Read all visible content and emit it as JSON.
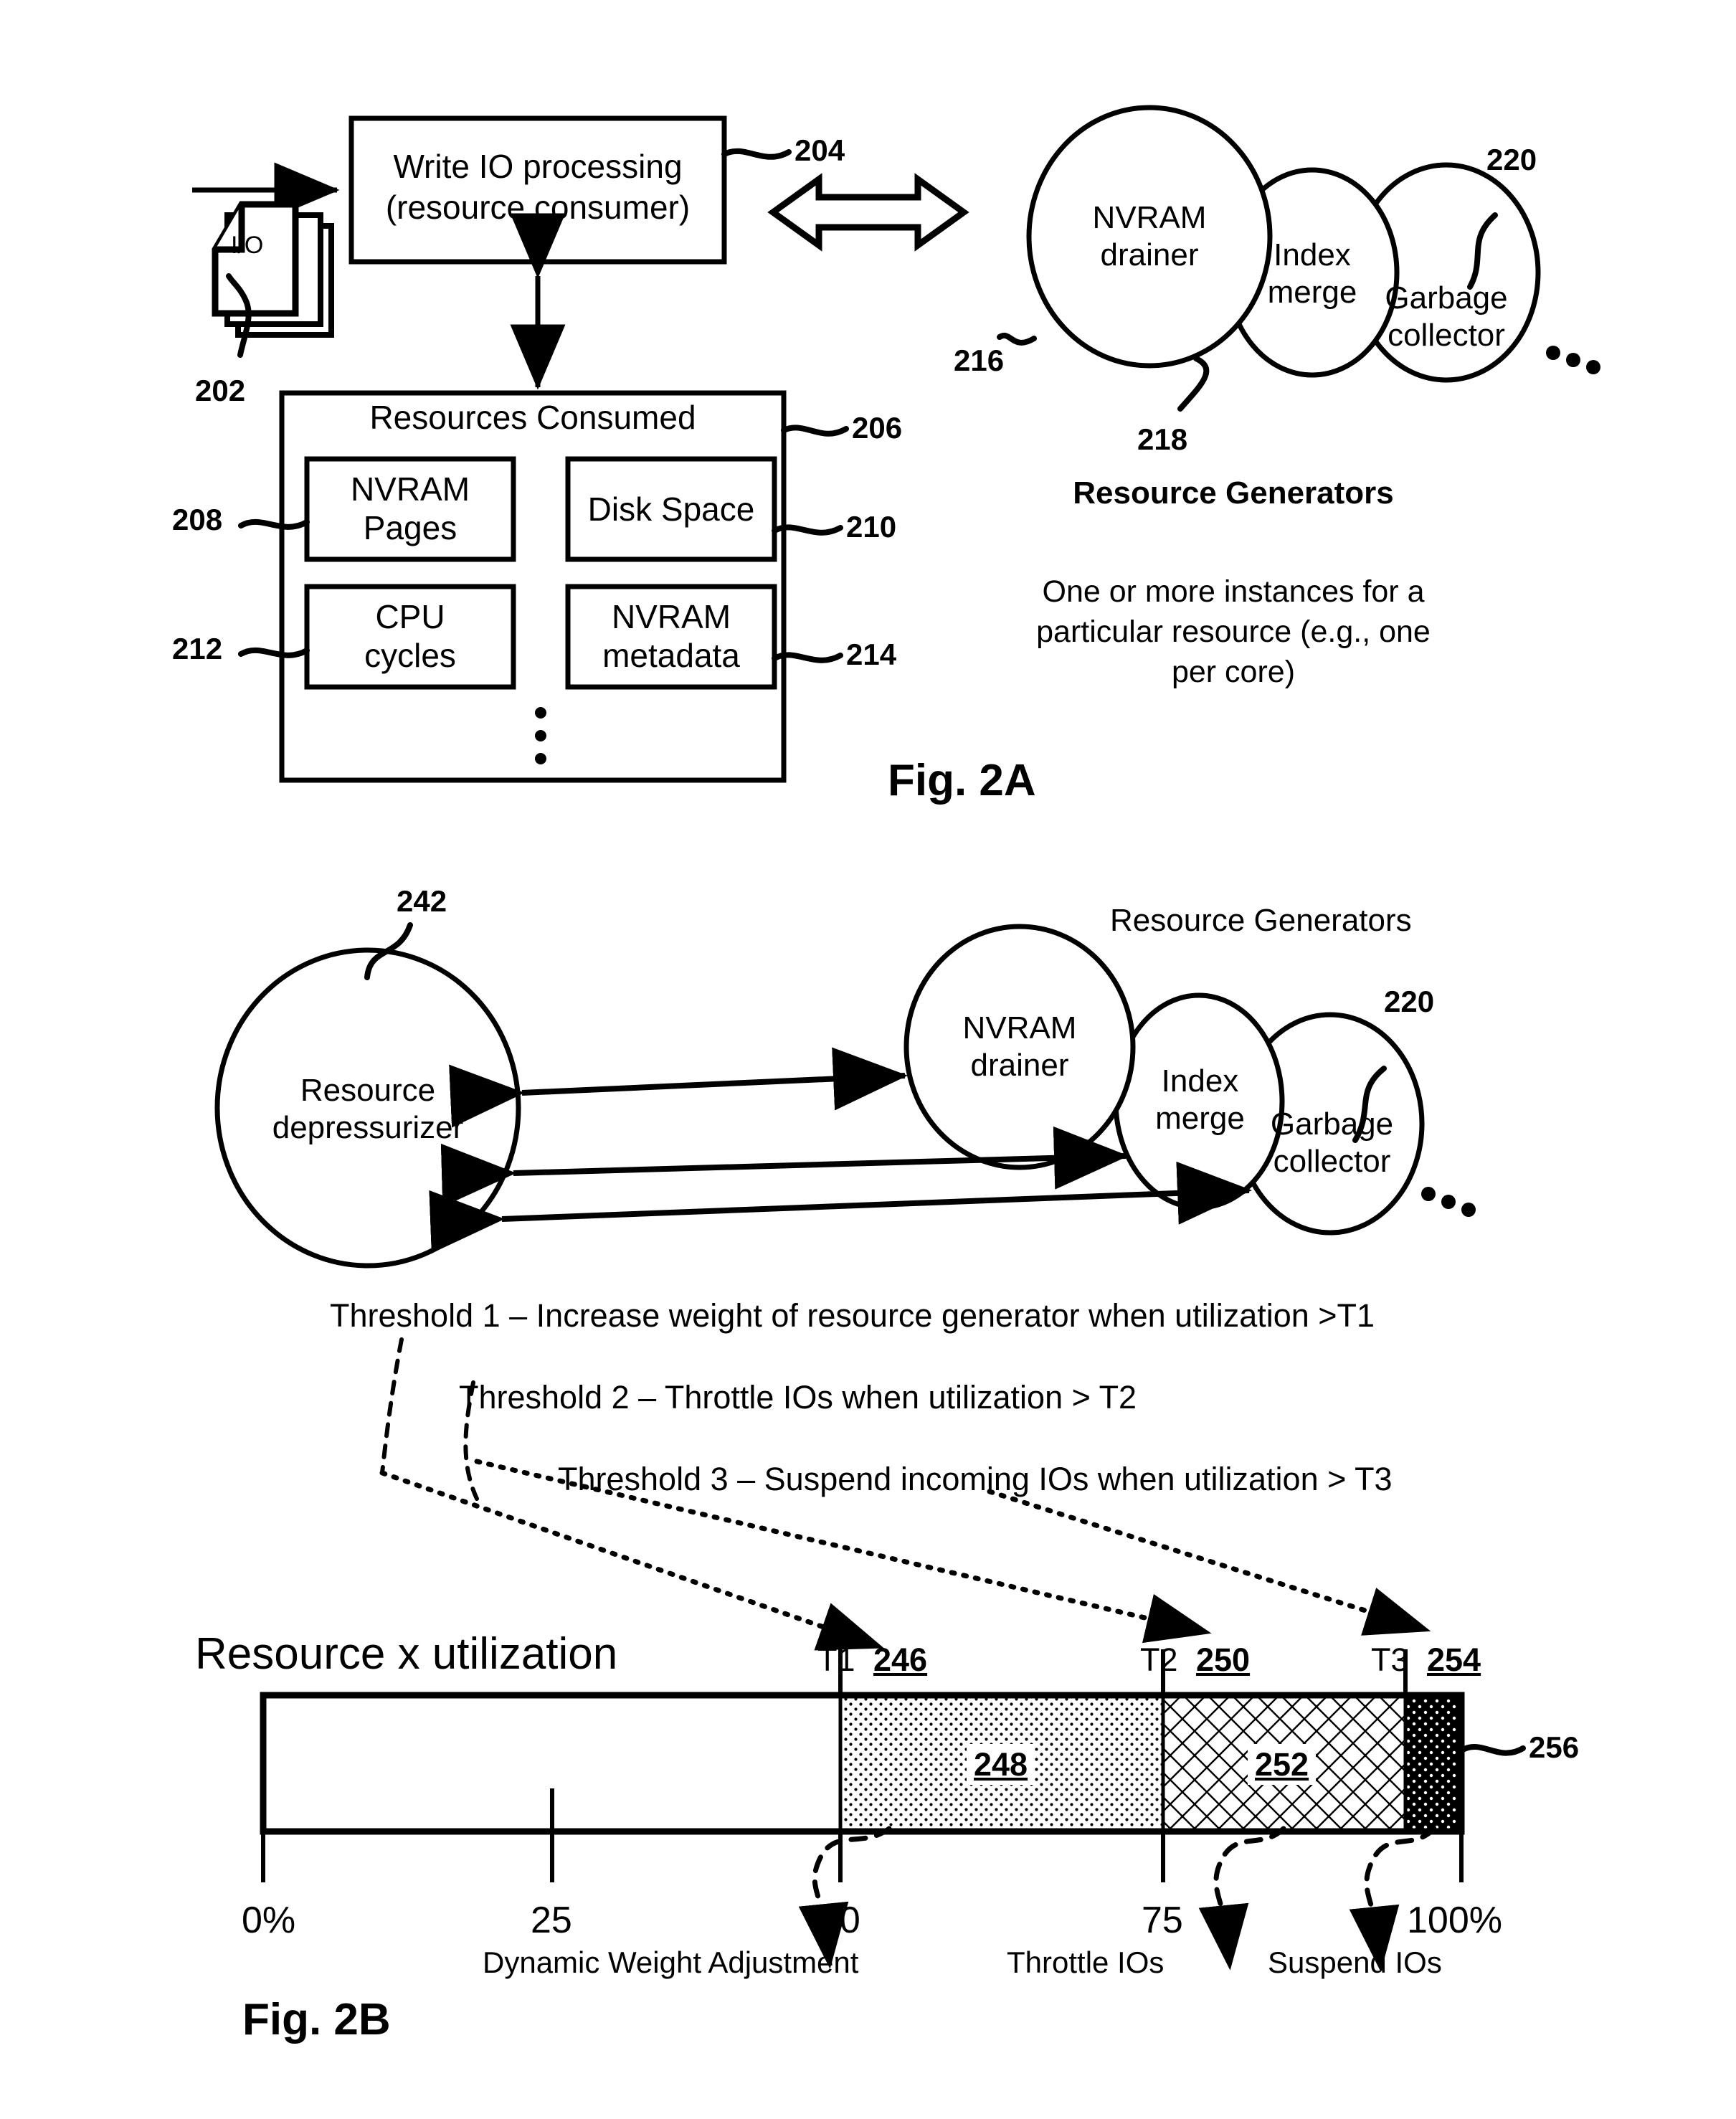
{
  "figures": {
    "fig2a_label": "Fig. 2A",
    "fig2b_label": "Fig. 2B"
  },
  "fig2a": {
    "io_icon_label": "I/O",
    "io_ref": "202",
    "consumer_box": {
      "line1": "Write IO processing",
      "line2": "(resource consumer)",
      "ref": "204"
    },
    "resources_box": {
      "title": "Resources Consumed",
      "ref": "206",
      "items": [
        {
          "line1": "NVRAM",
          "line2": "Pages",
          "ref": "208"
        },
        {
          "line1": "Disk Space",
          "line2": "",
          "ref": "210"
        },
        {
          "line1": "CPU",
          "line2": "cycles",
          "ref": "212"
        },
        {
          "line1": "NVRAM",
          "line2": "metadata",
          "ref": "214"
        }
      ],
      "ellipsis": "⋮"
    },
    "generators": {
      "heading": "Resource Generators",
      "circles": [
        {
          "line1": "NVRAM",
          "line2": "drainer",
          "ref": "216"
        },
        {
          "line1": "Index",
          "line2": "merge",
          "ref": "218"
        },
        {
          "line1": "Garbage",
          "line2": "collector",
          "ref": "220"
        }
      ],
      "more_dots": "•••",
      "note_line1": "One or more instances for a",
      "note_line2": "particular resource (e.g., one",
      "note_line3": "per core)"
    }
  },
  "fig2b": {
    "depressurizer": {
      "line1": "Resource",
      "line2": "depressurizer",
      "ref": "242"
    },
    "generators_heading": "Resource Generators",
    "circles": [
      {
        "line1": "NVRAM",
        "line2": "drainer"
      },
      {
        "line1": "Index",
        "line2": "merge"
      },
      {
        "line1": "Garbage",
        "line2": "collector",
        "ref": "220"
      }
    ],
    "more_dots": "•••",
    "thresholds": [
      "Threshold 1 – Increase weight of resource generator when utilization >T1",
      "Threshold 2 – Throttle IOs when utilization > T2",
      "Threshold 3 – Suspend incoming IOs when utilization > T3"
    ],
    "bar_title": "Resource x utilization",
    "markers": [
      {
        "name": "T1",
        "ref": "246"
      },
      {
        "name": "T2",
        "ref": "250"
      },
      {
        "name": "T3",
        "ref": "254"
      }
    ],
    "zone_refs": {
      "dotted": "248",
      "hatched": "252",
      "solid": "256"
    },
    "callouts": [
      "Dynamic Weight Adjustment",
      "Throttle IOs",
      "Suspend IOs"
    ]
  },
  "chart_data": {
    "type": "bar",
    "title": "Resource x utilization",
    "xlabel": "",
    "ylabel": "",
    "xlim": [
      0,
      100
    ],
    "tick_labels": [
      "0%",
      "25",
      "50",
      "75",
      "100%"
    ],
    "tick_values": [
      0,
      25,
      50,
      75,
      100
    ],
    "grid": false,
    "legend": "none",
    "thresholds": [
      {
        "name": "T1",
        "value": 50,
        "ref": "246"
      },
      {
        "name": "T2",
        "value": 78,
        "ref": "250"
      },
      {
        "name": "T3",
        "value": 95,
        "ref": "254"
      }
    ],
    "zones": [
      {
        "from": 0,
        "to": 50,
        "fill": "none",
        "ref": "",
        "action": ""
      },
      {
        "from": 50,
        "to": 78,
        "fill": "dotted",
        "ref": "248",
        "action": "Dynamic Weight Adjustment"
      },
      {
        "from": 78,
        "to": 95,
        "fill": "crosshatch",
        "ref": "252",
        "action": "Throttle IOs"
      },
      {
        "from": 95,
        "to": 100,
        "fill": "solid-dark",
        "ref": "256",
        "action": "Suspend IOs"
      }
    ]
  },
  "colors": {
    "ink": "#000000",
    "paper": "#ffffff"
  }
}
